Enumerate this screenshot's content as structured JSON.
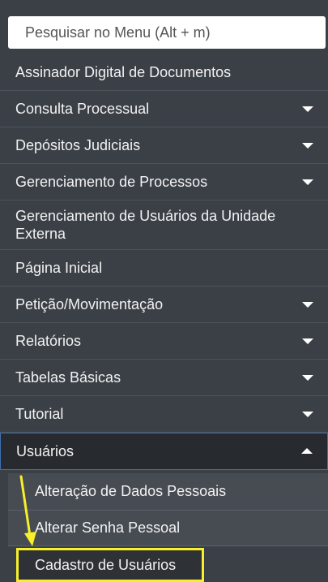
{
  "search": {
    "placeholder": "Pesquisar no Menu (Alt + m)"
  },
  "menu": {
    "items": [
      {
        "label": "Assinador Digital de Documentos",
        "has_caret": false
      },
      {
        "label": "Consulta Processual",
        "has_caret": true
      },
      {
        "label": "Depósitos Judiciais",
        "has_caret": true
      },
      {
        "label": "Gerenciamento de Processos",
        "has_caret": true
      },
      {
        "label": "Gerenciamento de Usuários da Unidade Externa",
        "has_caret": false
      },
      {
        "label": "Página Inicial",
        "has_caret": false
      },
      {
        "label": "Petição/Movimentação",
        "has_caret": true
      },
      {
        "label": "Relatórios",
        "has_caret": true
      },
      {
        "label": "Tabelas Básicas",
        "has_caret": true
      },
      {
        "label": "Tutorial",
        "has_caret": true
      },
      {
        "label": "Usuários",
        "has_caret": true,
        "expanded": true
      }
    ],
    "submenu": [
      {
        "label": "Alteração de Dados Pessoais"
      },
      {
        "label": "Alterar Senha Pessoal"
      },
      {
        "label": "Cadastro de Usuários",
        "highlighted": true
      }
    ]
  },
  "colors": {
    "panel_bg": "#3b4047",
    "highlight": "#f7ef2a",
    "active_border": "#3f6fb0"
  }
}
